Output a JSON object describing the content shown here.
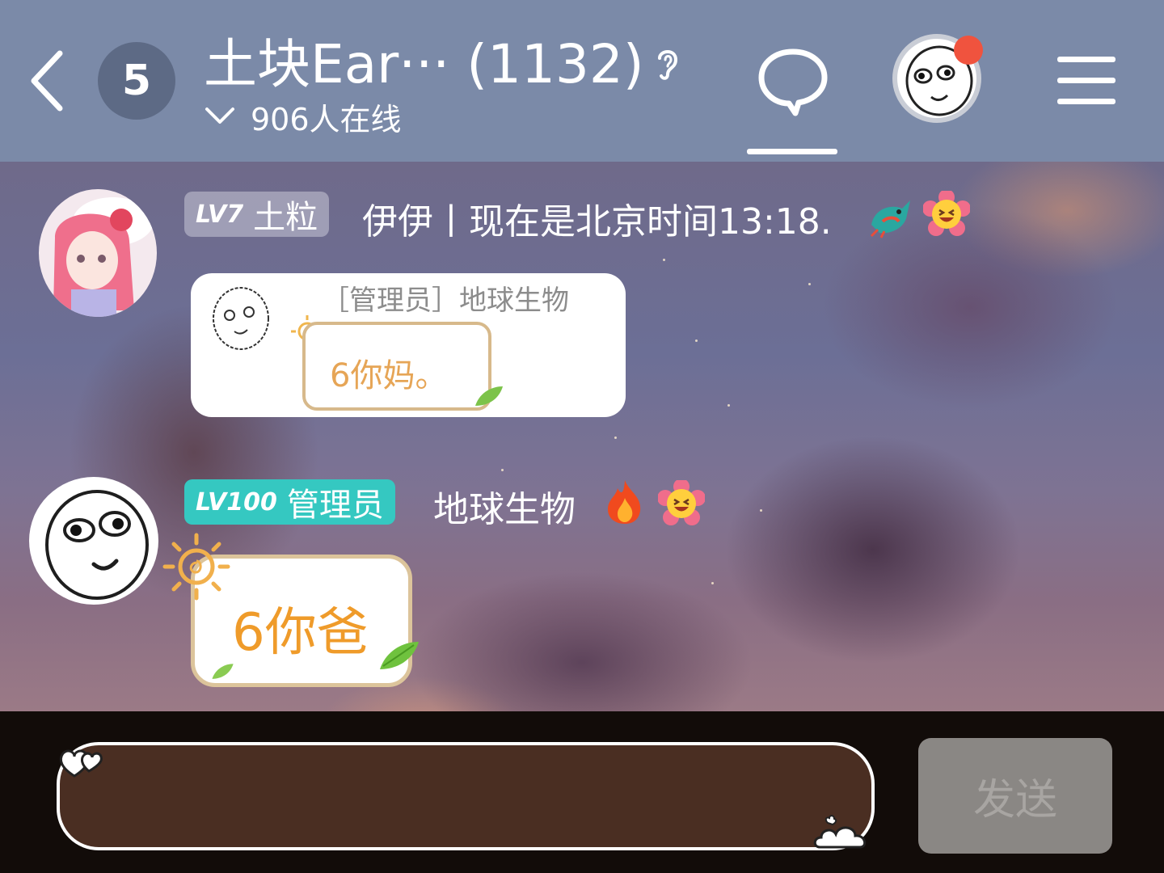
{
  "header": {
    "unread_count": "5",
    "title": "土块Ear··· (1132)",
    "online_text": "906人在线",
    "accent_color": "#7b8aa8",
    "notification_color": "#f0533e"
  },
  "messages": [
    {
      "level": "LV7",
      "tag": "土粒",
      "username": "伊伊丨现在是北京时间13:18.",
      "badge_icons": [
        "dragon-icon",
        "laughing-flower-icon"
      ],
      "image_message": {
        "caption": "［管理员］地球生物",
        "text": "6你妈。"
      }
    },
    {
      "level": "LV100",
      "tag": "管理员",
      "username": "地球生物",
      "badge_icons": [
        "fire-icon",
        "laughing-flower-icon"
      ],
      "text": "6你爸"
    }
  ],
  "input": {
    "value": "",
    "send_label": "发送"
  }
}
